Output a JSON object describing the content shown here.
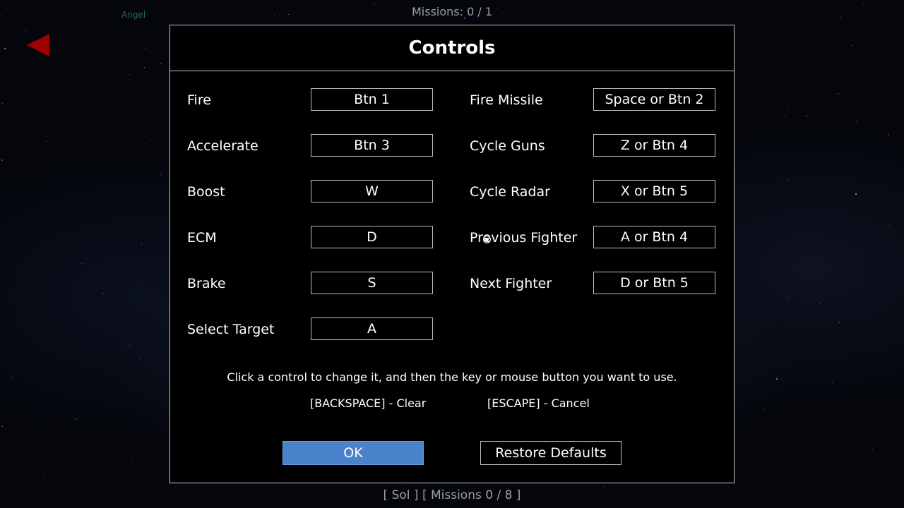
{
  "top_status": "Missions: 0 / 1",
  "pilot_name": "Angel",
  "dialog": {
    "title": "Controls",
    "left_controls": [
      {
        "label": "Fire",
        "key": "Btn 1"
      },
      {
        "label": "Accelerate",
        "key": "Btn 3"
      },
      {
        "label": "Boost",
        "key": "W"
      },
      {
        "label": "ECM",
        "key": "D"
      },
      {
        "label": "Brake",
        "key": "S"
      },
      {
        "label": "Select Target",
        "key": "A"
      }
    ],
    "right_controls": [
      {
        "label": "Fire Missile",
        "key": "Space or Btn 2"
      },
      {
        "label": "Cycle Guns",
        "key": "Z or Btn 4"
      },
      {
        "label": "Cycle Radar",
        "key": "X or Btn 5"
      },
      {
        "label": "Previous Fighter",
        "key": "A or Btn 4"
      },
      {
        "label": "Next Fighter",
        "key": "D or Btn 5"
      }
    ],
    "instructions": "Click a control to change it, and then the key or mouse button you want to use.",
    "hint_clear": "[BACKSPACE] - Clear",
    "hint_cancel": "[ESCAPE] - Cancel",
    "ok_label": "OK",
    "restore_label": "Restore Defaults"
  },
  "bottom_status": "[ Sol ]  [ Missions 0 / 8 ]",
  "colors": {
    "ok_button": "#4a82cc",
    "back_arrow": "#a10000",
    "status_text": "#9aa0a8"
  },
  "icons": {
    "back": "back-arrow-icon",
    "cursor": "cursor-ring-icon"
  }
}
